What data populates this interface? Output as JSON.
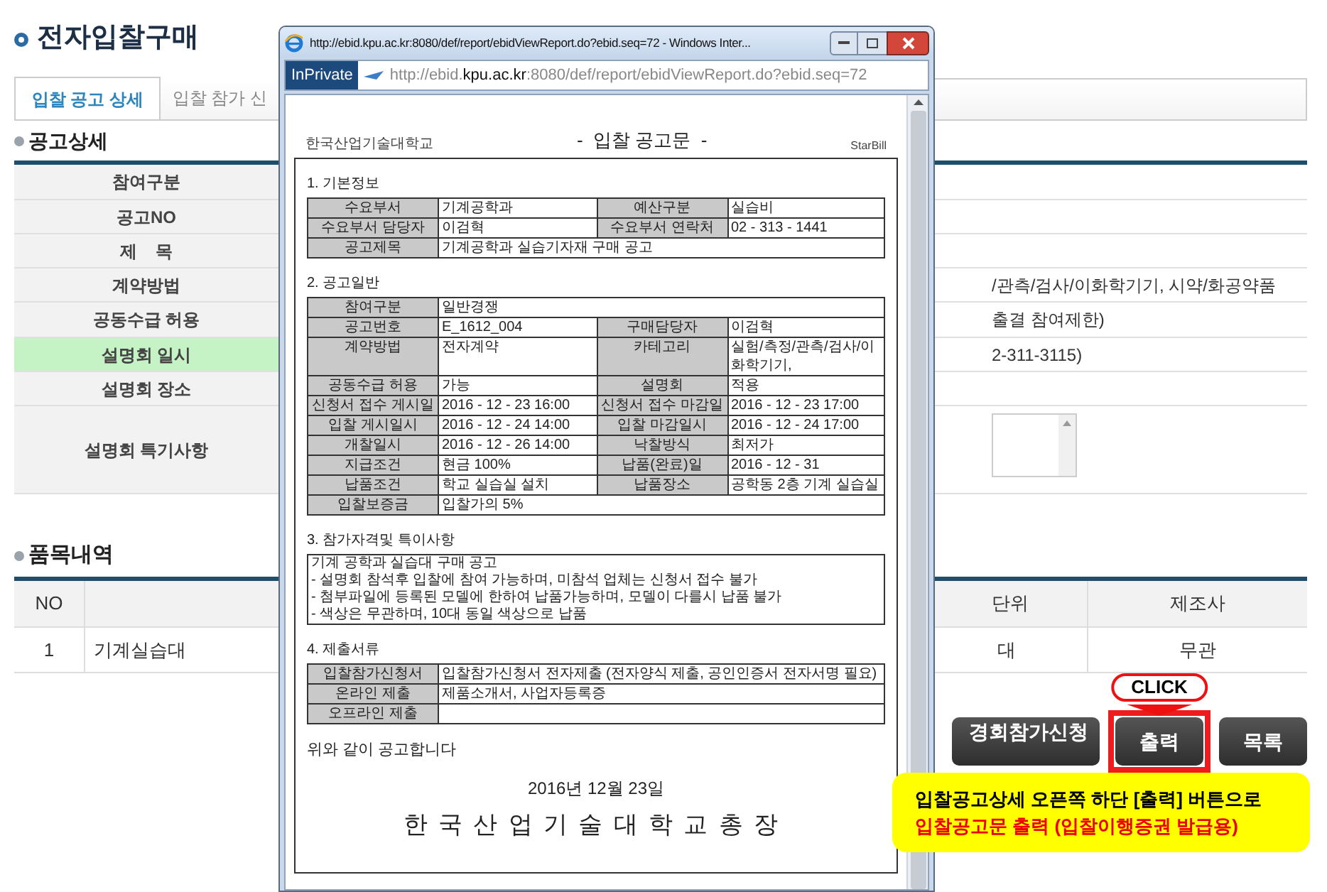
{
  "page_title": "전자입찰구매",
  "tabs": [
    {
      "label": "입찰 공고 상세",
      "selected": true
    },
    {
      "label": "입찰 참가 신",
      "selected": false
    }
  ],
  "notice_detail": {
    "title": "공고상세",
    "rows": [
      {
        "label": "참여구분",
        "kind": "text",
        "highlighted": false
      },
      {
        "label": "공고NO",
        "kind": "text",
        "highlighted": false
      },
      {
        "label": "제    목",
        "kind": "text",
        "highlighted": false
      },
      {
        "label": "계약방법",
        "kind": "text",
        "highlighted": false,
        "value": "/관측/검사/이화학기기, 시약/화공약품"
      },
      {
        "label": "공동수급 허용",
        "kind": "text",
        "highlighted": false,
        "value": "출결 참여제한)"
      },
      {
        "label": "설명회 일시",
        "kind": "text",
        "highlighted": true,
        "value": "2-311-3115)"
      },
      {
        "label": "설명회 장소",
        "kind": "text",
        "highlighted": false
      },
      {
        "label": "설명회 특기사항",
        "kind": "textarea",
        "highlighted": false
      }
    ]
  },
  "items": {
    "title": "품목내역",
    "left": {
      "columns": [
        "NO"
      ],
      "rows": [
        [
          "1",
          "기계실습대"
        ]
      ]
    },
    "right": {
      "columns": [
        "단위",
        "제조사"
      ],
      "rows": [
        [
          "대",
          "무관"
        ]
      ]
    }
  },
  "buttons": [
    {
      "label": "경회참가신청",
      "highlighted": false
    },
    {
      "label": "출력",
      "highlighted": true,
      "callout": "CLICK"
    },
    {
      "label": "목록",
      "highlighted": false
    }
  ],
  "note": {
    "lines": [
      {
        "text": "입찰공고상세 오픈쪽 하단 [출력] 버튼으로",
        "emphasis": false
      },
      {
        "text": "입찰공고문 출력 (입찰이행증권 발급용)",
        "emphasis": true
      }
    ]
  },
  "popup": {
    "title": "http://ebid.kpu.ac.kr:8080/def/report/ebidViewReport.do?ebid.seq=72 - Windows Inter...",
    "badge": "InPrivate",
    "address": "http://ebid.**kpu.ac.kr**:8080/def/report/ebidViewReport.do?ebid.seq=72",
    "document": {
      "org": "한국산업기술대학교",
      "title": "-  입찰 공고문  -",
      "brand": "StarBill",
      "sections": [
        {
          "heading": "1. 기본정보",
          "kind": "table",
          "rows": [
            [
              {
                "label": "수요부서",
                "value": "기계공학과"
              },
              {
                "label": "예산구분",
                "value": "실습비"
              }
            ],
            [
              {
                "label": "수요부서 담당자",
                "value": "이검혁"
              },
              {
                "label": "수요부서 연락처",
                "value": "02 - 313 - 1441"
              }
            ],
            [
              {
                "label": "공고제목",
                "value": "기계공학과 실습기자재 구매 공고"
              }
            ]
          ]
        },
        {
          "heading": "2. 공고일반",
          "kind": "table",
          "rows": [
            [
              {
                "label": "참여구분",
                "value": "일반경쟁"
              }
            ],
            [
              {
                "label": "공고번호",
                "value": "E_1612_004"
              },
              {
                "label": "구매담당자",
                "value": "이검혁"
              }
            ],
            [
              {
                "label": "계약방법",
                "value": "전자계약"
              },
              {
                "label": "카테고리",
                "value": "실험/측정/관측/검사/이화학기기,"
              }
            ],
            [
              {
                "label": "공동수급 허용",
                "value": "가능"
              },
              {
                "label": "설명회",
                "value": "적용"
              }
            ],
            [
              {
                "label": "신청서 접수 게시일",
                "value": "2016 - 12 - 23 16:00"
              },
              {
                "label": "신청서 접수 마감일",
                "value": "2016 - 12 - 23 17:00"
              }
            ],
            [
              {
                "label": "입찰 게시일시",
                "value": "2016 - 12 - 24 14:00"
              },
              {
                "label": "입찰 마감일시",
                "value": "2016 - 12 - 24 17:00"
              }
            ],
            [
              {
                "label": "개찰일시",
                "value": "2016 - 12 - 26 14:00"
              },
              {
                "label": "낙찰방식",
                "value": "최저가"
              }
            ],
            [
              {
                "label": "지급조건",
                "value": "현금 100%"
              },
              {
                "label": "납품(완료)일",
                "value": "2016 - 12 - 31"
              }
            ],
            [
              {
                "label": "납품조건",
                "value": "학교 실습실 설치"
              },
              {
                "label": "납품장소",
                "value": "공학동 2층 기계 실습실"
              }
            ],
            [
              {
                "label": "입찰보증금",
                "value": "입찰가의 5%"
              }
            ]
          ]
        },
        {
          "heading": "3. 참가자격및 특이사항",
          "kind": "text",
          "lines": [
            "기계 공학과 실습대 구매 공고",
            "- 설명회 참석후 입찰에 참여 가능하며, 미참석 업체는 신청서 접수 불가",
            "- 첨부파일에 등록된 모델에 한하여 납품가능하며, 모델이 다를시 납품 불가",
            "- 색상은 무관하며, 10대 동일 색상으로 납품"
          ]
        },
        {
          "heading": "4. 제출서류",
          "kind": "table",
          "rows": [
            [
              {
                "label": "입찰참가신청서",
                "value": "입찰참가신청서 전자제출 (전자양식 제출, 공인인증서 전자서명 필요)"
              }
            ],
            [
              {
                "label": "온라인 제출",
                "value": "제품소개서, 사업자등록증"
              }
            ],
            [
              {
                "label": "오프라인 제출"
              }
            ]
          ]
        }
      ],
      "closing": "위와 같이 공고합니다",
      "date": "2016년 12월 23일",
      "signer": "한국산업기술대학교총장"
    }
  }
}
